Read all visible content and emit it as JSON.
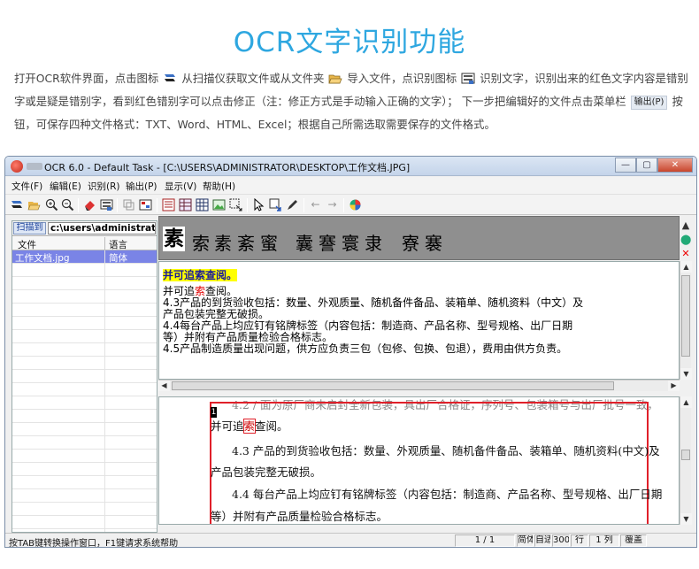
{
  "hero": {
    "title": "OCR文字识别功能"
  },
  "intro": {
    "p1": "打开OCR软件界面，点击图标",
    "p2": "从扫描仪获取文件或从文件夹",
    "p3": "导入文件，点识别图标",
    "p4": "识别文字，识别出来的红色文字内容是错别字或是疑是错别字，看到红色错别字可以点击修正（注：修正方式是手动输入正确的文字）；  下一步把编辑好的文件点击菜单栏",
    "menu_chip": "输出(P)",
    "p5": "按钮，可保存四种文件格式：TXT、Word、HTML、Excel；根据自己所需选取需要保存的文件格式。"
  },
  "window": {
    "title": "OCR 6.0 - Default Task - [C:\\USERS\\ADMINISTRATOR\\DESKTOP\\工作文档.JPG]",
    "minimize": "—",
    "maximize": "▢",
    "close": "✕"
  },
  "menu": [
    "文件(F)",
    "编辑(E)",
    "识别(R)",
    "输出(P)",
    "显示(V)",
    "帮助(H)"
  ],
  "left_panel": {
    "scan_button": "扫描到",
    "scan_path": "c:\\users\\administrator",
    "col_file": "文件",
    "col_lang": "语言",
    "rows": [
      {
        "file": "工作文档.jpg",
        "lang": "简体"
      }
    ]
  },
  "glyph_candidates": {
    "current": "素",
    "options": [
      "索",
      "素",
      "紊",
      "蜜",
      "囊",
      "謇",
      "寰",
      "隶",
      "寮",
      "褰"
    ]
  },
  "recognized": {
    "line1": "并可追索查阅。",
    "line2_pre": "并可追",
    "line2_err": "索",
    "line2_post": "查阅。",
    "line3": "   4.3产品的到货验收包括：数量、外观质量、随机备件备品、装箱单、随机资料（中文）及",
    "line4": "产品包装完整无破损。",
    "line5": "   4.4每台产品上均应钉有铭牌标签（内容包括：制造商、产品名称、型号规格、出厂日期",
    "line6": "等）并附有产品质量检验合格标志。",
    "line7": "   4.5产品制造质量出现问题，供方应负责三包（包修、包换、包退），费用由供方负责。"
  },
  "image_text": {
    "top": "4.2 / 面为原厂商未启封全新包装，具出厂合格证，序列号、包装箱号与出厂批号一致，",
    "cursor": "1",
    "l1": "并可追",
    "l1_box": "索",
    "l1_post": "查阅。",
    "l2": "4.3 产品的到货验收包括：数量、外观质量、随机备件备品、装箱单、随机资料(中文)及",
    "l3": "产品包装完整无破损。",
    "l4": "4.4 每台产品上均应钉有铭牌标签（内容包括：制造商、产品名称、型号规格、出厂日期",
    "l5": "等）并附有产品质量检验合格标志。"
  },
  "status": {
    "text": "按TAB键转换操作窗口，F1键请求系统帮助",
    "page": "1 / 1",
    "mode": "简体",
    "auto": "自适",
    "dpi": "300",
    "row_label": "行",
    "col_info": "1 列",
    "overwrite": "覆盖"
  },
  "colors": {
    "accent": "#2ea7e0",
    "error": "#e00000",
    "selection": "#7a84e6"
  }
}
